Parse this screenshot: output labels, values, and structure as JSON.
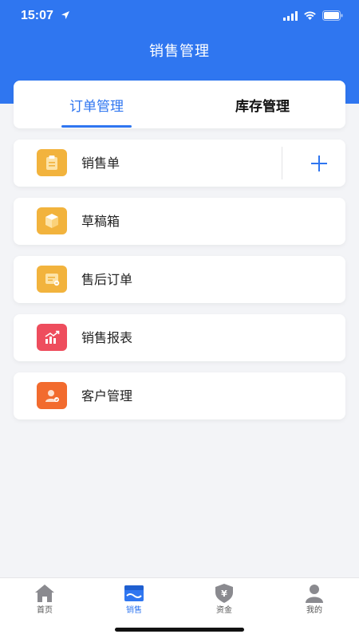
{
  "status_bar": {
    "time": "15:07"
  },
  "header": {
    "title": "销售管理"
  },
  "tabs": [
    {
      "label": "订单管理",
      "active": true
    },
    {
      "label": "库存管理",
      "active": false
    }
  ],
  "menu": [
    {
      "label": "销售单",
      "icon": "clipboard-icon",
      "icon_color": "#f2b33d"
    },
    {
      "label": "草稿箱",
      "icon": "box-icon",
      "icon_color": "#f2b33d"
    },
    {
      "label": "售后订单",
      "icon": "order-icon",
      "icon_color": "#f2b33d"
    },
    {
      "label": "销售报表",
      "icon": "chart-icon",
      "icon_color": "#ee4d5d"
    },
    {
      "label": "客户管理",
      "icon": "customer-icon",
      "icon_color": "#f26b2e"
    }
  ],
  "tabbar": [
    {
      "label": "首页",
      "icon": "home-icon",
      "active": false
    },
    {
      "label": "销售",
      "icon": "sales-icon",
      "active": true
    },
    {
      "label": "资金",
      "icon": "fund-shield-icon",
      "active": false
    },
    {
      "label": "我的",
      "icon": "profile-icon",
      "active": false
    }
  ],
  "colors": {
    "primary": "#2f76f0",
    "background": "#f3f4f7",
    "tabbar_inactive": "#8a8a8f"
  }
}
